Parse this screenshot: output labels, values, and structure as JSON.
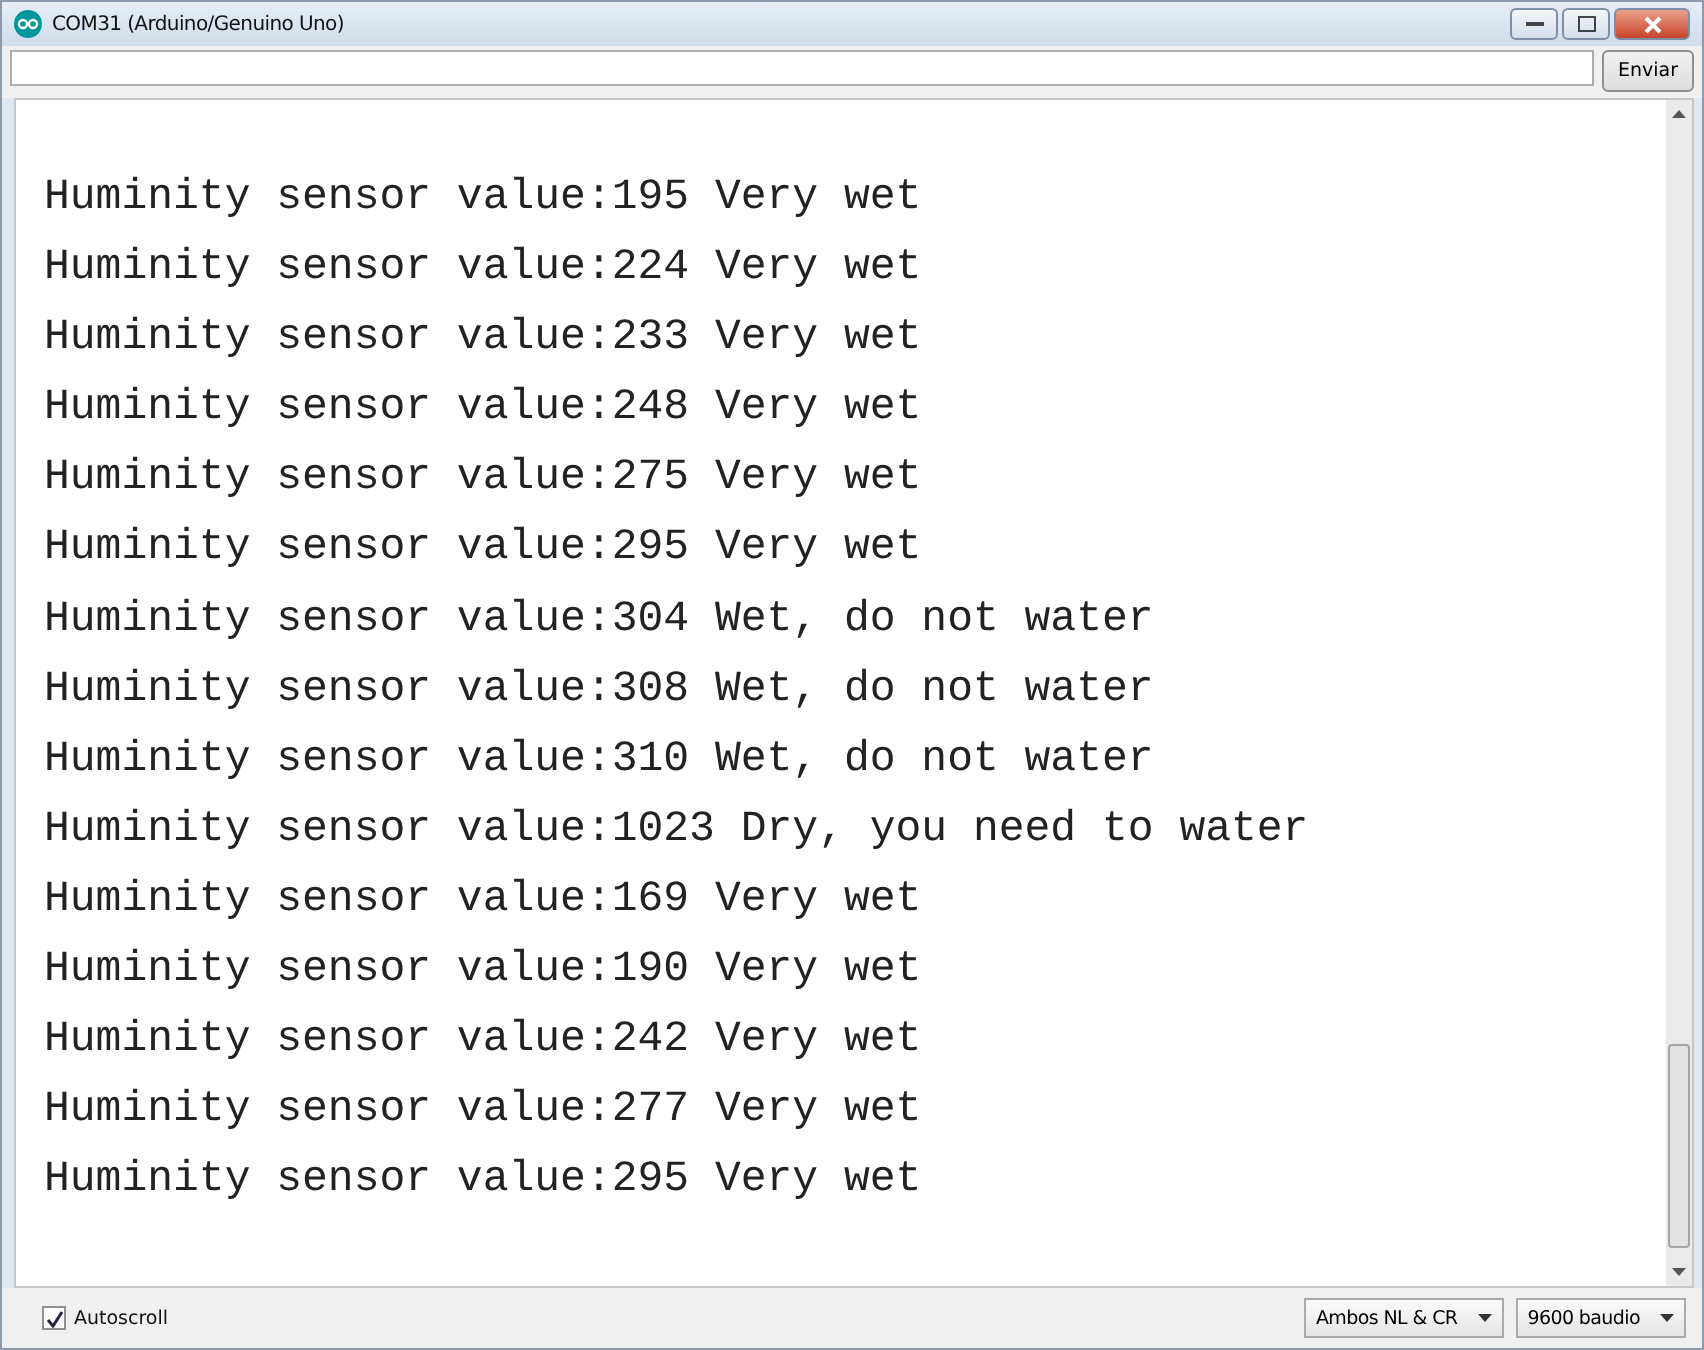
{
  "window": {
    "title": "COM31 (Arduino/Genuino Uno)"
  },
  "send_bar": {
    "button": "Enviar"
  },
  "output": {
    "lines": [
      "Huminity sensor value:195 Very wet",
      "Huminity sensor value:224 Very wet",
      "Huminity sensor value:233 Very wet",
      "Huminity sensor value:248 Very wet",
      "Huminity sensor value:275 Very wet",
      "Huminity sensor value:295 Very wet",
      "Huminity sensor value:304 Wet, do not water",
      "Huminity sensor value:308 Wet, do not water",
      "Huminity sensor value:310 Wet, do not water",
      "Huminity sensor value:1023 Dry, you need to water",
      "Huminity sensor value:169 Very wet",
      "Huminity sensor value:190 Very wet",
      "Huminity sensor value:242 Very wet",
      "Huminity sensor value:277 Very wet",
      "Huminity sensor value:295 Very wet"
    ]
  },
  "status_bar": {
    "autoscroll": {
      "label": "Autoscroll",
      "checked": true
    },
    "line_ending": "Ambos NL & CR",
    "baud_rate": "9600 baudio"
  }
}
